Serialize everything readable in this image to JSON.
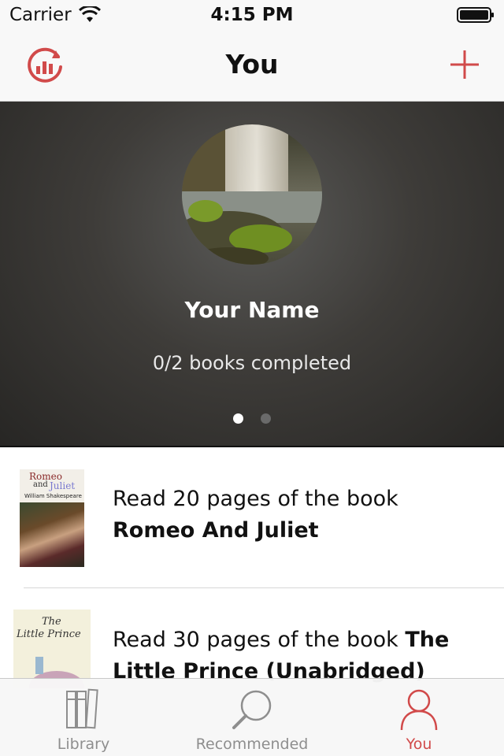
{
  "status_bar": {
    "carrier": "Carrier",
    "time": "4:15 PM"
  },
  "nav": {
    "title": "You",
    "left_icon": "sync-stats-icon",
    "right_icon": "plus-icon",
    "accent_color": "#d14a4a"
  },
  "profile": {
    "name": "Your Name",
    "books_completed": "0/2 books completed",
    "page_count": 2,
    "active_page": 0
  },
  "goals": [
    {
      "prefix": "Read 20 pages of the book",
      "book_title": "Romeo And Juliet",
      "cover": {
        "line1": "Romeo",
        "line2a": "and",
        "line2b": "Juliet",
        "author": "William Shakespeare"
      }
    },
    {
      "prefix": "Read 30 pages of the book",
      "book_title": "The Little Prince (Unabridged)",
      "cover": {
        "line1": "The",
        "line2": "Little Prince"
      }
    }
  ],
  "tabs": [
    {
      "label": "Library",
      "icon": "library-books-icon",
      "selected": false
    },
    {
      "label": "Recommended",
      "icon": "magnifier-icon",
      "selected": false
    },
    {
      "label": "You",
      "icon": "person-icon",
      "selected": true
    }
  ]
}
